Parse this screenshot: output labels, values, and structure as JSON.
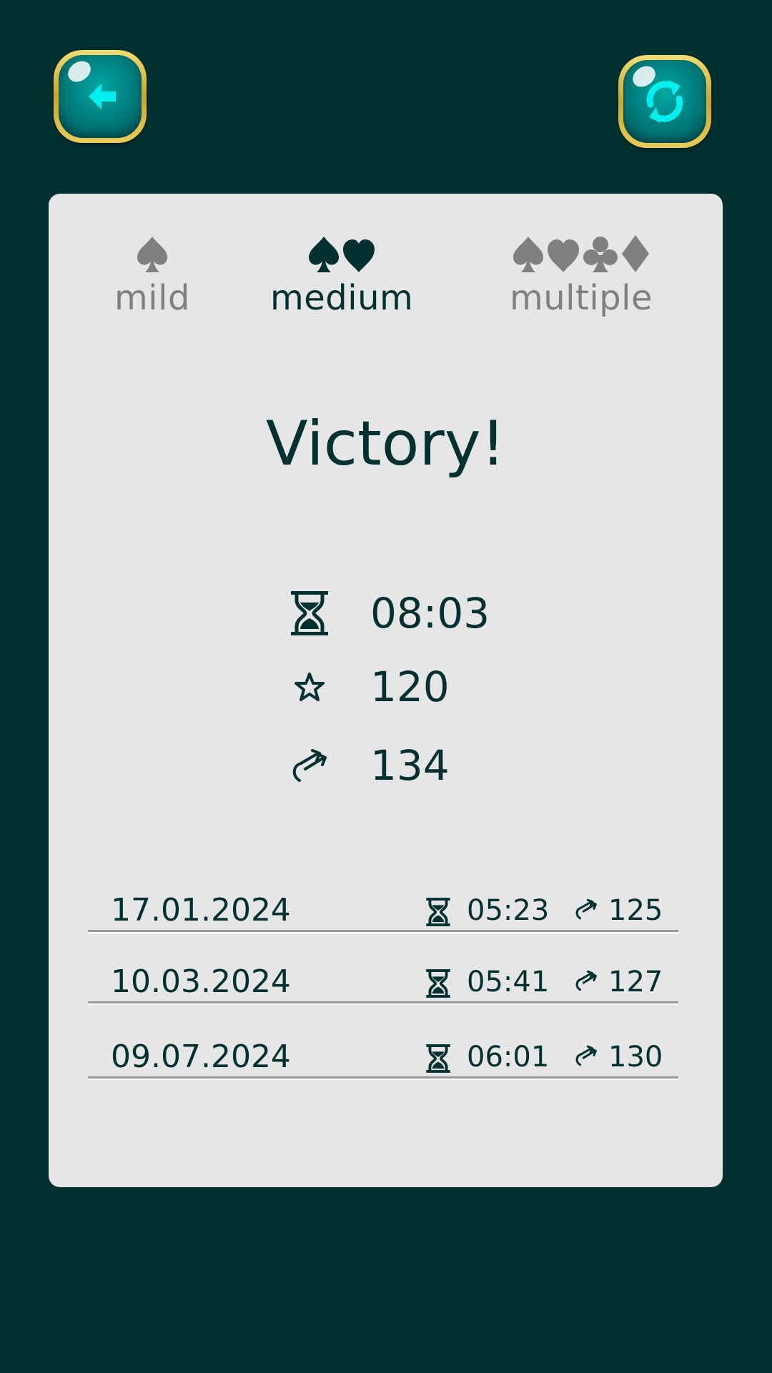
{
  "colors": {
    "background": "#003030",
    "panel": "#e6e6e6",
    "active_text": "#003030",
    "inactive_text": "#808080",
    "button_face": "#008c8a",
    "button_icon": "#00f0f0",
    "button_rim": "#e0c24a"
  },
  "buttons": {
    "back_icon": "arrow-left-icon",
    "restart_icon": "refresh-icon"
  },
  "difficulty": {
    "options": [
      {
        "label": "mild",
        "suits": [
          "spade"
        ],
        "active": false
      },
      {
        "label": "medium",
        "suits": [
          "spade",
          "heart"
        ],
        "active": true
      },
      {
        "label": "multiple",
        "suits": [
          "spade",
          "heart",
          "club",
          "diamond"
        ],
        "active": false
      }
    ]
  },
  "result": {
    "title": "Victory!",
    "time": "08:03",
    "score": "120",
    "moves": "134"
  },
  "history": [
    {
      "date": "17.01.2024",
      "time": "05:23",
      "moves": "125"
    },
    {
      "date": "10.03.2024",
      "time": "05:41",
      "moves": "127"
    },
    {
      "date": "09.07.2024",
      "time": "06:01",
      "moves": "130"
    }
  ]
}
